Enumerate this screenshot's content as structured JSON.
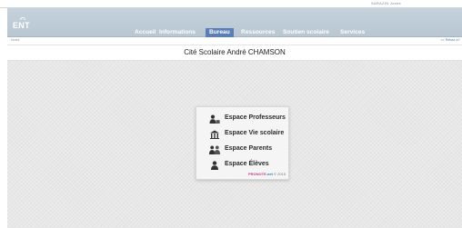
{
  "topbar": {
    "user_text": "SARAZIN Josée"
  },
  "header": {
    "logo_text": "ENT"
  },
  "menu": [
    {
      "label": "Accueil",
      "active": false
    },
    {
      "label": "Informations",
      "active": false
    },
    {
      "label": "Bureau",
      "active": true
    },
    {
      "label": "Ressources",
      "active": false
    },
    {
      "label": "Soutien scolaire",
      "active": false
    },
    {
      "label": "Services",
      "active": false
    }
  ],
  "breadcrumb": {
    "label": "Notes"
  },
  "back_link": {
    "label": "<< Retour à l'"
  },
  "page": {
    "title": "Cité Scolaire André CHAMSON"
  },
  "spaces": {
    "items": [
      {
        "label": "Espace Professeurs",
        "icon": "teacher-icon"
      },
      {
        "label": "Espace Vie scolaire",
        "icon": "school-building-icon"
      },
      {
        "label": "Espace Parents",
        "icon": "parents-icon"
      },
      {
        "label": "Espace Élèves",
        "icon": "student-icon"
      }
    ],
    "footer_brand_a": "PRONOTE",
    "footer_brand_b": ".net",
    "footer_copyright": "© 2015"
  },
  "colors": {
    "header": "#bccad5",
    "active_tab": "#5a7fb8",
    "background": "#e8e8e8"
  }
}
